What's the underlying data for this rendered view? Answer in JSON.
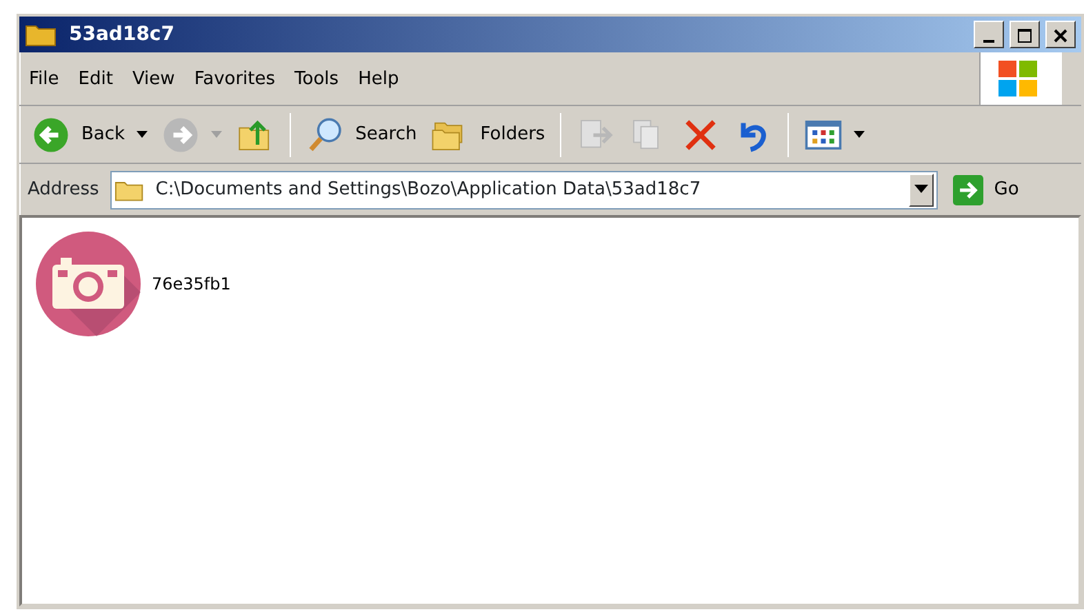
{
  "window": {
    "title": "53ad18c7"
  },
  "menu": [
    "File",
    "Edit",
    "View",
    "Favorites",
    "Tools",
    "Help"
  ],
  "toolbar": [
    {
      "kind": "back",
      "label": "Back",
      "disabled": false,
      "dropdown": true
    },
    {
      "kind": "forward",
      "disabled": true,
      "dropdown": true
    },
    {
      "kind": "up",
      "disabled": false
    },
    {
      "kind": "sep"
    },
    {
      "kind": "search",
      "label": "Search",
      "disabled": false
    },
    {
      "kind": "folders",
      "label": "Folders",
      "disabled": false
    },
    {
      "kind": "sep"
    },
    {
      "kind": "move",
      "disabled": true
    },
    {
      "kind": "copy",
      "disabled": true
    },
    {
      "kind": "delete",
      "disabled": false
    },
    {
      "kind": "undo",
      "disabled": false
    },
    {
      "kind": "sep"
    },
    {
      "kind": "views",
      "disabled": false,
      "dropdown": true
    }
  ],
  "address": {
    "label": "Address",
    "value": "C:\\Documents and Settings\\Bozo\\Application Data\\53ad18c7",
    "go": "Go"
  },
  "files": [
    {
      "name": "76e35fb1"
    }
  ]
}
